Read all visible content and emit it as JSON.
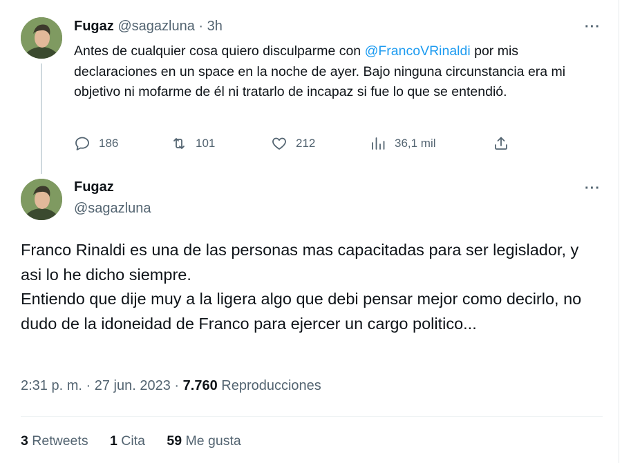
{
  "tweet1": {
    "name": "Fugaz",
    "handle": "@sagazluna",
    "dot": "·",
    "time": "3h",
    "more": "···",
    "text_before": "Antes de cualquier cosa quiero disculparme con ",
    "mention": "@FrancoVRinaldi",
    "text_after": " por mis declaraciones en un space en la noche de ayer. Bajo ninguna circunstancia  era mi objetivo ni mofarme de él ni tratarlo de incapaz si fue lo que se entendió.",
    "actions": {
      "replies": "186",
      "retweets": "101",
      "likes": "212",
      "views": "36,1 mil"
    }
  },
  "tweet2": {
    "name": "Fugaz",
    "handle": "@sagazluna",
    "more": "···",
    "lines": [
      "Franco Rinaldi es una de las personas mas capacitadas para ser legislador, y asi lo he dicho siempre.",
      "Entiendo que dije muy a la ligera algo que debi pensar mejor como decirlo, no dudo de la idoneidad de Franco para ejercer un cargo politico..."
    ],
    "time": "2:31 p. m.",
    "sep": "·",
    "date": "27 jun. 2023",
    "views_count": "7.760",
    "views_label": "Reproducciones",
    "stats": {
      "retweets_count": "3",
      "retweets_label": "Retweets",
      "quotes_count": "1",
      "quotes_label": "Cita",
      "likes_count": "59",
      "likes_label": "Me gusta"
    }
  },
  "icons": {
    "reply": "reply-icon",
    "retweet": "retweet-icon",
    "like": "heart-icon",
    "views": "views-icon",
    "share": "share-icon"
  },
  "colors": {
    "mention": "#1d9bf0",
    "muted": "#536471",
    "text": "#0f1419"
  }
}
